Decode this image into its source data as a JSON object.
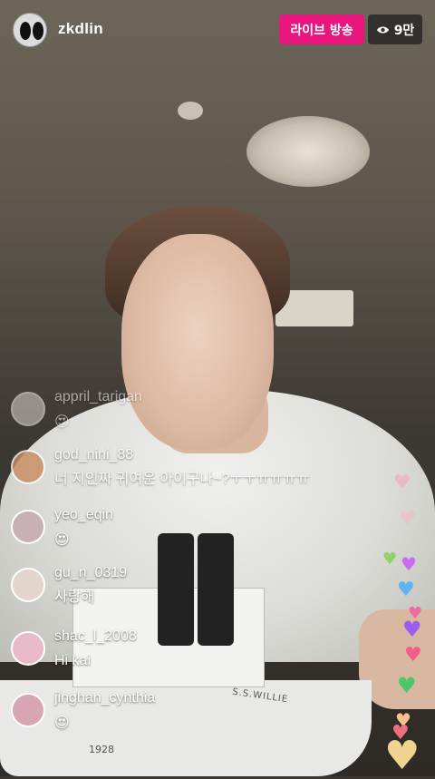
{
  "header": {
    "username": "zkdlin",
    "live_label": "라이브 방송",
    "viewer_count": "9만",
    "viewer_icon": "eye-icon"
  },
  "comments": [
    {
      "user": "appril_tarigan",
      "text": "😍",
      "avatar_color": "#d9d5d0"
    },
    {
      "user": "god_nini_88",
      "text": "너 지인짜 귀여운 아이구나~?ㅜㅜㅠㅠㅠㅠ",
      "avatar_color": "#c98b5f"
    },
    {
      "user": "yeo_eqin",
      "text": "😍",
      "avatar_color": "#c7b0b6"
    },
    {
      "user": "gu_n_0319",
      "text": "사랑해",
      "avatar_color": "#e3d4cc"
    },
    {
      "user": "shac_l_2008",
      "text": "Hi kai",
      "avatar_color": "#e8b9c9"
    },
    {
      "user": "jinghan_cynthia",
      "text": "😍",
      "avatar_color": "#d7a6b2"
    }
  ],
  "scene_text": {
    "boat_name": "S.S.WILLIE",
    "boat_number": "1928"
  },
  "hearts": [
    {
      "icon": "heart-icon",
      "color": "#f4a7c3"
    },
    {
      "icon": "heart-icon",
      "color": "#f7b6c9"
    },
    {
      "icon": "heart-icon",
      "color": "#8fd16a"
    },
    {
      "icon": "heart-icon",
      "color": "#c86cf0"
    },
    {
      "icon": "heart-icon",
      "color": "#5fb3f0"
    },
    {
      "icon": "heart-icon",
      "color": "#f06aa2"
    },
    {
      "icon": "heart-icon",
      "color": "#9b5cf0"
    },
    {
      "icon": "heart-icon",
      "color": "#f25c8a"
    },
    {
      "icon": "heart-icon",
      "color": "#4fc46e"
    },
    {
      "icon": "heart-icon",
      "color": "#f7c38a"
    },
    {
      "icon": "heart-icon",
      "color": "#ef6f7e"
    },
    {
      "icon": "heart-icon",
      "color": "#f1d28f"
    }
  ]
}
